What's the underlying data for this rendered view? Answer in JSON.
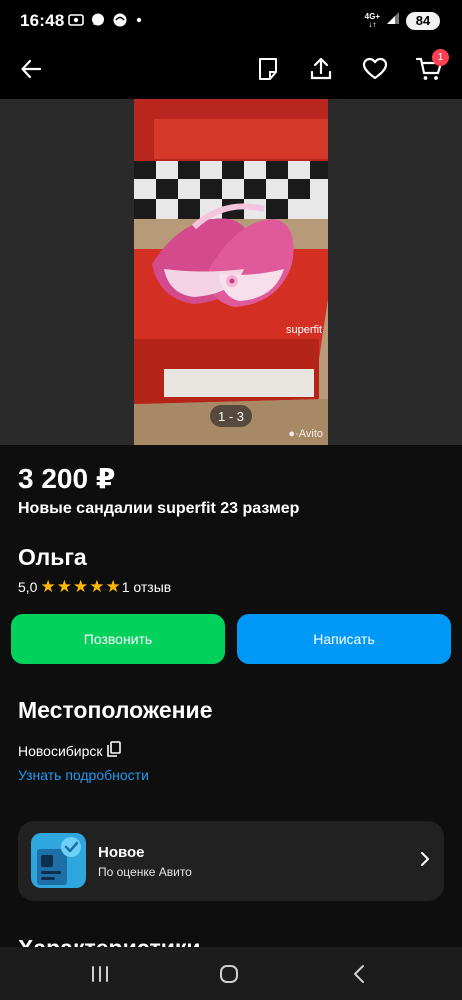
{
  "status_bar": {
    "time": "16:48",
    "network_top": "4G+",
    "network_bottom": "↓↑",
    "battery": "84"
  },
  "app_bar": {
    "cart_badge": "1",
    "icons": [
      "back-arrow-icon",
      "note-icon",
      "share-icon",
      "heart-icon",
      "cart-icon"
    ]
  },
  "gallery": {
    "counter": "1 - 3",
    "watermark": "Avito",
    "box_brand": "superfit"
  },
  "listing": {
    "price": "3 200 ₽",
    "title": "Новые сандалии superfit 23 размер"
  },
  "seller": {
    "name": "Ольга",
    "rating": "5,0",
    "stars": 5,
    "reviews": "1 отзыв"
  },
  "actions": {
    "call": "Позвонить",
    "write": "Написать"
  },
  "location": {
    "heading": "Местоположение",
    "city": "Новосибирск",
    "details_link": "Узнать подробности"
  },
  "condition": {
    "title": "Новое",
    "subtitle": "По оценке Авито"
  },
  "next_section": {
    "heading": "Характеристики"
  },
  "colors": {
    "call_button": "#02d15c",
    "write_button": "#0099f7",
    "link": "#1f9bf0",
    "star": "#ffb800",
    "badge": "#ff4053"
  }
}
